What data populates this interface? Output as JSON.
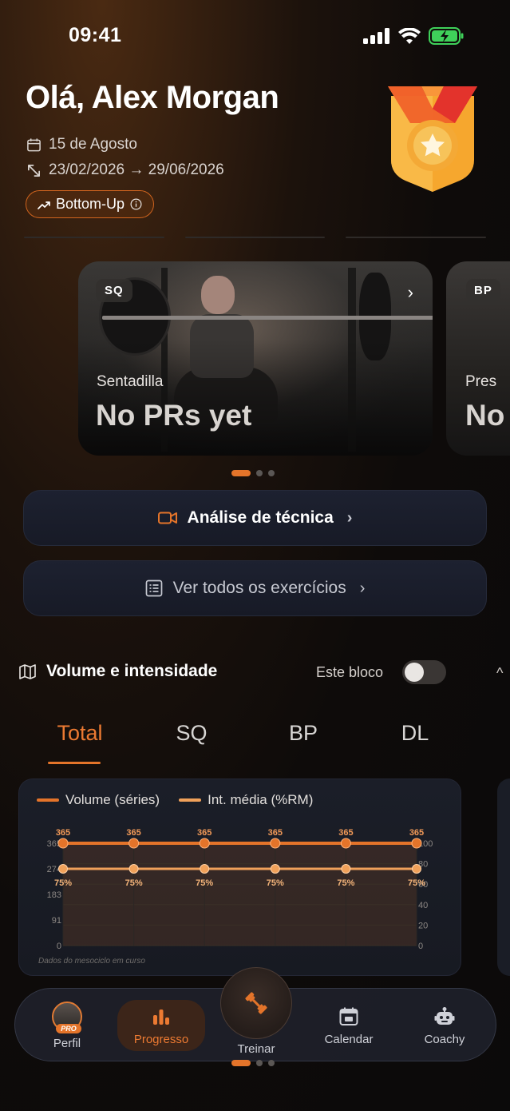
{
  "status_bar": {
    "time": "09:41"
  },
  "header": {
    "greeting": "Olá, Alex Morgan",
    "date": "15 de Agosto",
    "date_range": "23/02/2026 → 29/06/2026",
    "method_chip": "Bottom-Up"
  },
  "carousel": {
    "cards": [
      {
        "tag": "SQ",
        "exercise": "Sentadilla",
        "pr_text": "No PRs yet"
      },
      {
        "tag": "BP",
        "exercise": "Pres",
        "pr_text": "No"
      }
    ],
    "active_index": 0,
    "count": 3
  },
  "actions": {
    "technique_label": "Análise de técnica",
    "all_exercises_label": "Ver todos os exercícios"
  },
  "volume_section": {
    "title": "Volume e intensidade",
    "block_toggle_label": "Este bloco",
    "block_toggle_on": false,
    "tabs": [
      "Total",
      "SQ",
      "BP",
      "DL"
    ],
    "active_tab": "Total",
    "footnote": "Dados do mesociclo em curso"
  },
  "chart_data": {
    "type": "line",
    "x": [
      1,
      2,
      3,
      4,
      5,
      6
    ],
    "series": [
      {
        "name": "Volume (séries)",
        "axis": "left",
        "color": "#e4742a",
        "values": [
          365,
          365,
          365,
          365,
          365,
          365
        ],
        "labels": [
          "365",
          "365",
          "365",
          "365",
          "365",
          "365"
        ]
      },
      {
        "name": "Int. média (%RM)",
        "axis": "right",
        "color": "#f0a15a",
        "values": [
          75,
          75,
          75,
          75,
          75,
          75
        ],
        "labels": [
          "75%",
          "75%",
          "75%",
          "75%",
          "75%",
          "75%"
        ]
      }
    ],
    "left_ticks": [
      "365",
      "274",
      "183",
      "91",
      "0"
    ],
    "left_tick_values": [
      365,
      274,
      183,
      91,
      0
    ],
    "right_ticks": [
      "100",
      "80",
      "60",
      "40",
      "20",
      "0"
    ],
    "right_tick_values": [
      100,
      80,
      60,
      40,
      20,
      0
    ],
    "ylim_left": [
      0,
      365
    ],
    "ylim_right": [
      0,
      100
    ],
    "grid": true,
    "legend_position": "top-left"
  },
  "bottom_nav": {
    "items": [
      {
        "id": "perfil",
        "label": "Perfil",
        "badge": "PRO"
      },
      {
        "id": "progresso",
        "label": "Progresso",
        "active": true
      },
      {
        "id": "treinar",
        "label": "Treinar"
      },
      {
        "id": "calendar",
        "label": "Calendar"
      },
      {
        "id": "coachy",
        "label": "Coachy"
      }
    ]
  },
  "colors": {
    "accent": "#e4742a",
    "accent_light": "#f0a15a",
    "card_bg": "#1b1e28",
    "background": "#0e0b0a"
  }
}
